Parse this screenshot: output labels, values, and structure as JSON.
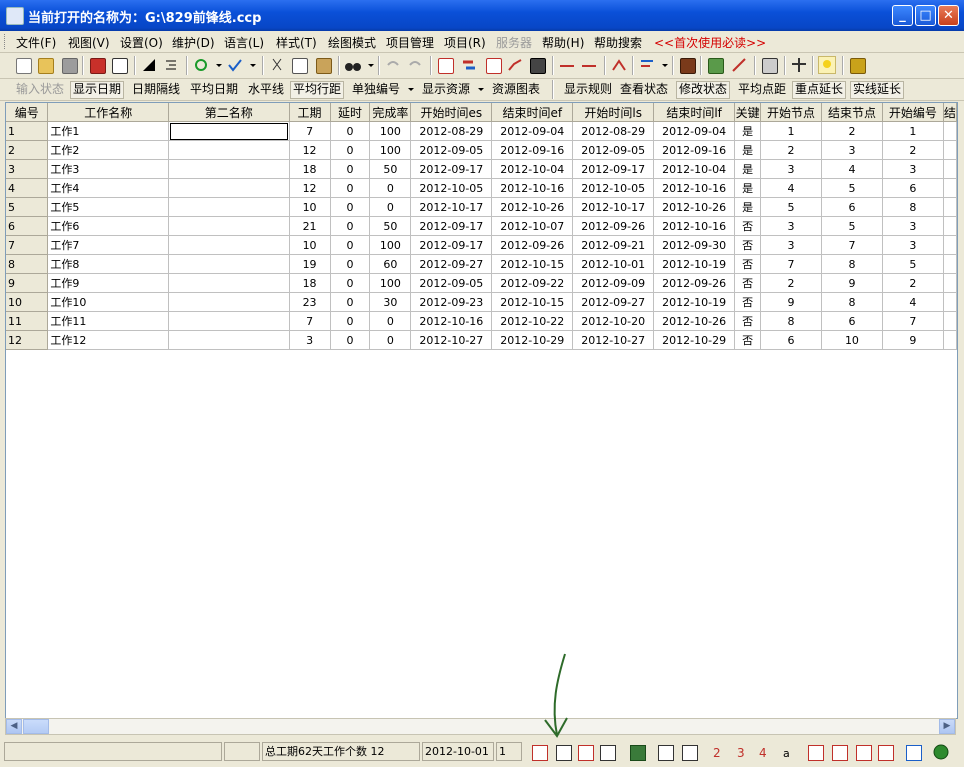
{
  "window": {
    "title": "当前打开的名称为：G:\\829前锋线.ccp",
    "minimize_glyph": "_",
    "maximize_glyph": "□",
    "close_glyph": "✕"
  },
  "menu": {
    "items": [
      {
        "label": "文件(F)"
      },
      {
        "label": "视图(V)"
      },
      {
        "label": "设置(O)"
      },
      {
        "label": "维护(D)"
      },
      {
        "label": "语言(L)"
      },
      {
        "label": "样式(T)"
      },
      {
        "label": "绘图模式"
      },
      {
        "label": "项目管理"
      },
      {
        "label": "项目(R)"
      },
      {
        "label": "服务器",
        "disabled": true
      },
      {
        "label": "帮助(H)"
      },
      {
        "label": "帮助搜索"
      },
      {
        "label": "<<首次使用必读>>",
        "accent": "#d40000"
      }
    ]
  },
  "toolbar2": {
    "items": [
      {
        "label": "输入状态",
        "disabled": true
      },
      {
        "label": "显示日期",
        "boxed": true
      },
      {
        "label": "日期隔线"
      },
      {
        "label": "平均日期"
      },
      {
        "label": "水平线"
      },
      {
        "label": "平均行距",
        "boxed": true
      },
      {
        "label": "单独编号"
      },
      {
        "label": "显示资源"
      },
      {
        "label": "资源图表"
      },
      {
        "label": "显示规则"
      },
      {
        "label": "查看状态"
      },
      {
        "label": "修改状态",
        "boxed": true
      },
      {
        "label": "平均点距"
      },
      {
        "label": "重点延长",
        "boxed": true
      },
      {
        "label": "实线延长",
        "boxed": true
      }
    ]
  },
  "grid": {
    "columns": [
      "编号",
      "工作名称",
      "第二名称",
      "工期",
      "延时",
      "完成率",
      "开始时间es",
      "结束时间ef",
      "开始时间ls",
      "结束时间lf",
      "关键",
      "开始节点",
      "结束节点",
      "开始编号",
      "结"
    ],
    "rows": [
      [
        "1",
        "工作1",
        "",
        "7",
        "0",
        "100",
        "2012-08-29",
        "2012-09-04",
        "2012-08-29",
        "2012-09-04",
        "是",
        "1",
        "2",
        "1"
      ],
      [
        "2",
        "工作2",
        "",
        "12",
        "0",
        "100",
        "2012-09-05",
        "2012-09-16",
        "2012-09-05",
        "2012-09-16",
        "是",
        "2",
        "3",
        "2"
      ],
      [
        "3",
        "工作3",
        "",
        "18",
        "0",
        "50",
        "2012-09-17",
        "2012-10-04",
        "2012-09-17",
        "2012-10-04",
        "是",
        "3",
        "4",
        "3"
      ],
      [
        "4",
        "工作4",
        "",
        "12",
        "0",
        "0",
        "2012-10-05",
        "2012-10-16",
        "2012-10-05",
        "2012-10-16",
        "是",
        "4",
        "5",
        "6"
      ],
      [
        "5",
        "工作5",
        "",
        "10",
        "0",
        "0",
        "2012-10-17",
        "2012-10-26",
        "2012-10-17",
        "2012-10-26",
        "是",
        "5",
        "6",
        "8"
      ],
      [
        "6",
        "工作6",
        "",
        "21",
        "0",
        "50",
        "2012-09-17",
        "2012-10-07",
        "2012-09-26",
        "2012-10-16",
        "否",
        "3",
        "5",
        "3"
      ],
      [
        "7",
        "工作7",
        "",
        "10",
        "0",
        "100",
        "2012-09-17",
        "2012-09-26",
        "2012-09-21",
        "2012-09-30",
        "否",
        "3",
        "7",
        "3"
      ],
      [
        "8",
        "工作8",
        "",
        "19",
        "0",
        "60",
        "2012-09-27",
        "2012-10-15",
        "2012-10-01",
        "2012-10-19",
        "否",
        "7",
        "8",
        "5"
      ],
      [
        "9",
        "工作9",
        "",
        "18",
        "0",
        "100",
        "2012-09-05",
        "2012-09-22",
        "2012-09-09",
        "2012-09-26",
        "否",
        "2",
        "9",
        "2"
      ],
      [
        "10",
        "工作10",
        "",
        "23",
        "0",
        "30",
        "2012-09-23",
        "2012-10-15",
        "2012-09-27",
        "2012-10-19",
        "否",
        "9",
        "8",
        "4"
      ],
      [
        "11",
        "工作11",
        "",
        "7",
        "0",
        "0",
        "2012-10-16",
        "2012-10-22",
        "2012-10-20",
        "2012-10-26",
        "否",
        "8",
        "6",
        "7"
      ],
      [
        "12",
        "工作12",
        "",
        "3",
        "0",
        "0",
        "2012-10-27",
        "2012-10-29",
        "2012-10-27",
        "2012-10-29",
        "否",
        "6",
        "10",
        "9"
      ]
    ]
  },
  "status": {
    "summary": "总工期62天工作个数 12",
    "date": "2012-10-01",
    "page": "1"
  },
  "toolbar_icons": [
    "new-file-icon",
    "open-folder-icon",
    "save-icon",
    "export-icon",
    "print-preview-icon",
    "fill-icon",
    "indent-icon",
    "refresh-icon",
    "check-icon",
    "cut-icon",
    "copy-icon",
    "paste-icon",
    "find-icon",
    "undo-icon",
    "redo-icon",
    "network-view-icon",
    "gantt-view-icon",
    "list-view-icon",
    "line-chart-icon",
    "resource-icon",
    "node-a-icon",
    "node-b-icon",
    "logic-icon",
    "align-icon",
    "books-icon",
    "tools-icon",
    "edit-icon",
    "monitor-icon",
    "plane-icon",
    "bulb-icon",
    "lock-icon"
  ],
  "status_icons": [
    "network-diagram-icon",
    "table-view-icon",
    "time-table-icon",
    "frame-icon",
    "print-icon",
    "calendar-icon",
    "page-right-icon",
    "zoom-2-icon",
    "zoom-3-icon",
    "zoom-4-icon",
    "zoom-a-icon",
    "fit-height-icon",
    "fit-width-icon",
    "shift-right-icon",
    "shift-left-icon",
    "fit-page-icon",
    "globe-icon"
  ],
  "colors": {
    "title_gradient_top": "#2b6ff0",
    "title_gradient_bottom": "#063aa8",
    "accent_red": "#d40000",
    "annotation_green": "#2e6b2a",
    "grid_line": "#c0c0c0"
  }
}
